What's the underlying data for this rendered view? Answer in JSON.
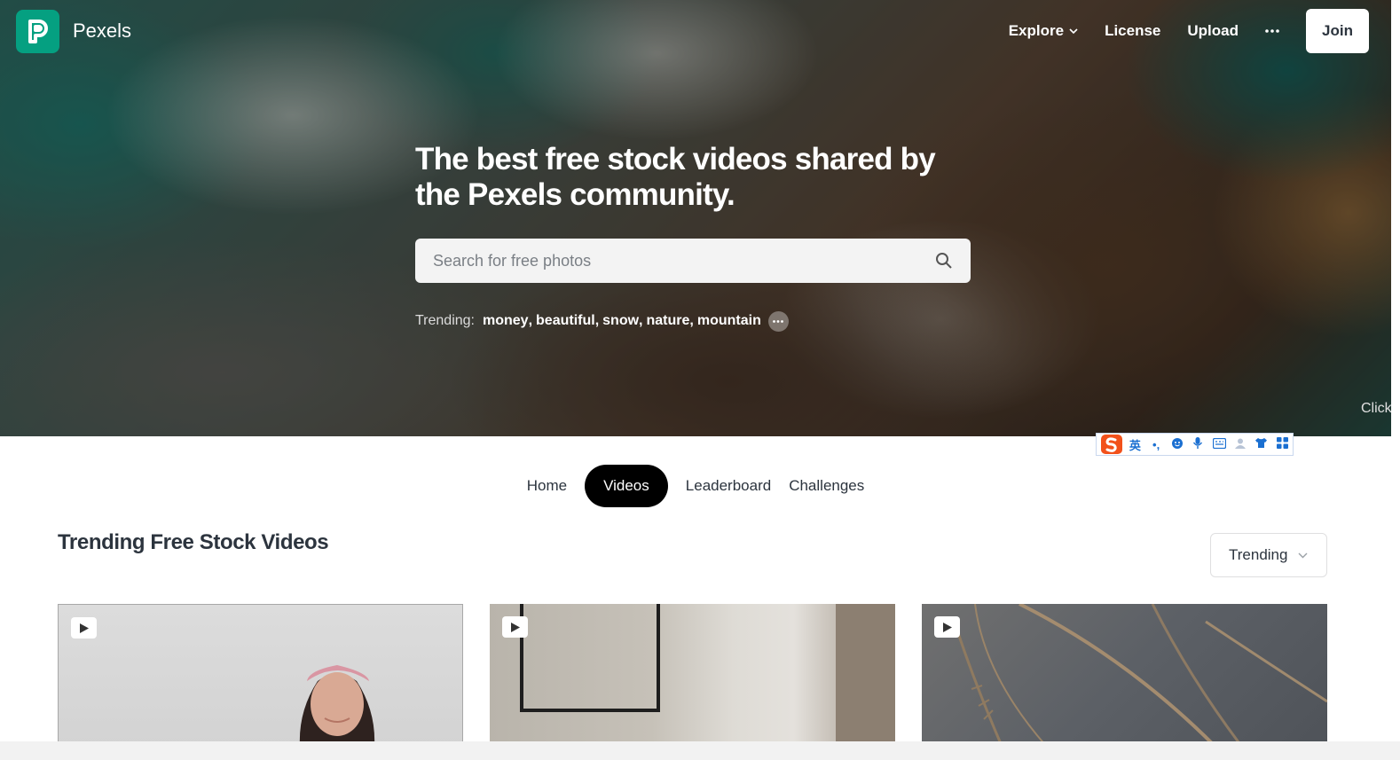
{
  "brand": {
    "name": "Pexels",
    "logo_color": "#05a081"
  },
  "nav": {
    "items": [
      {
        "label": "Explore",
        "has_dropdown": true
      },
      {
        "label": "License"
      },
      {
        "label": "Upload"
      }
    ],
    "more_icon": "more-horizontal-icon",
    "join_label": "Join"
  },
  "hero": {
    "title": "The best free stock videos shared by the Pexels community.",
    "search_placeholder": "Search for free photos",
    "search_icon": "search-icon",
    "trending_label": "Trending:",
    "trending": [
      "money",
      "beautiful",
      "snow",
      "nature",
      "mountain"
    ],
    "click_hint": "Click"
  },
  "ime": {
    "lang": "英",
    "punct": "•,",
    "icons": [
      "emoji-icon",
      "mic-icon",
      "keyboard-icon",
      "user-icon",
      "shirt-icon",
      "apps-icon"
    ]
  },
  "tabs": [
    {
      "label": "Home",
      "active": false
    },
    {
      "label": "Videos",
      "active": true
    },
    {
      "label": "Leaderboard",
      "active": false
    },
    {
      "label": "Challenges",
      "active": false
    }
  ],
  "section": {
    "title": "Trending Free Stock Videos",
    "sort_label": "Trending"
  },
  "cards": [
    {
      "type": "video",
      "icon": "play-icon"
    },
    {
      "type": "video",
      "icon": "play-icon"
    },
    {
      "type": "video",
      "icon": "play-icon"
    }
  ]
}
